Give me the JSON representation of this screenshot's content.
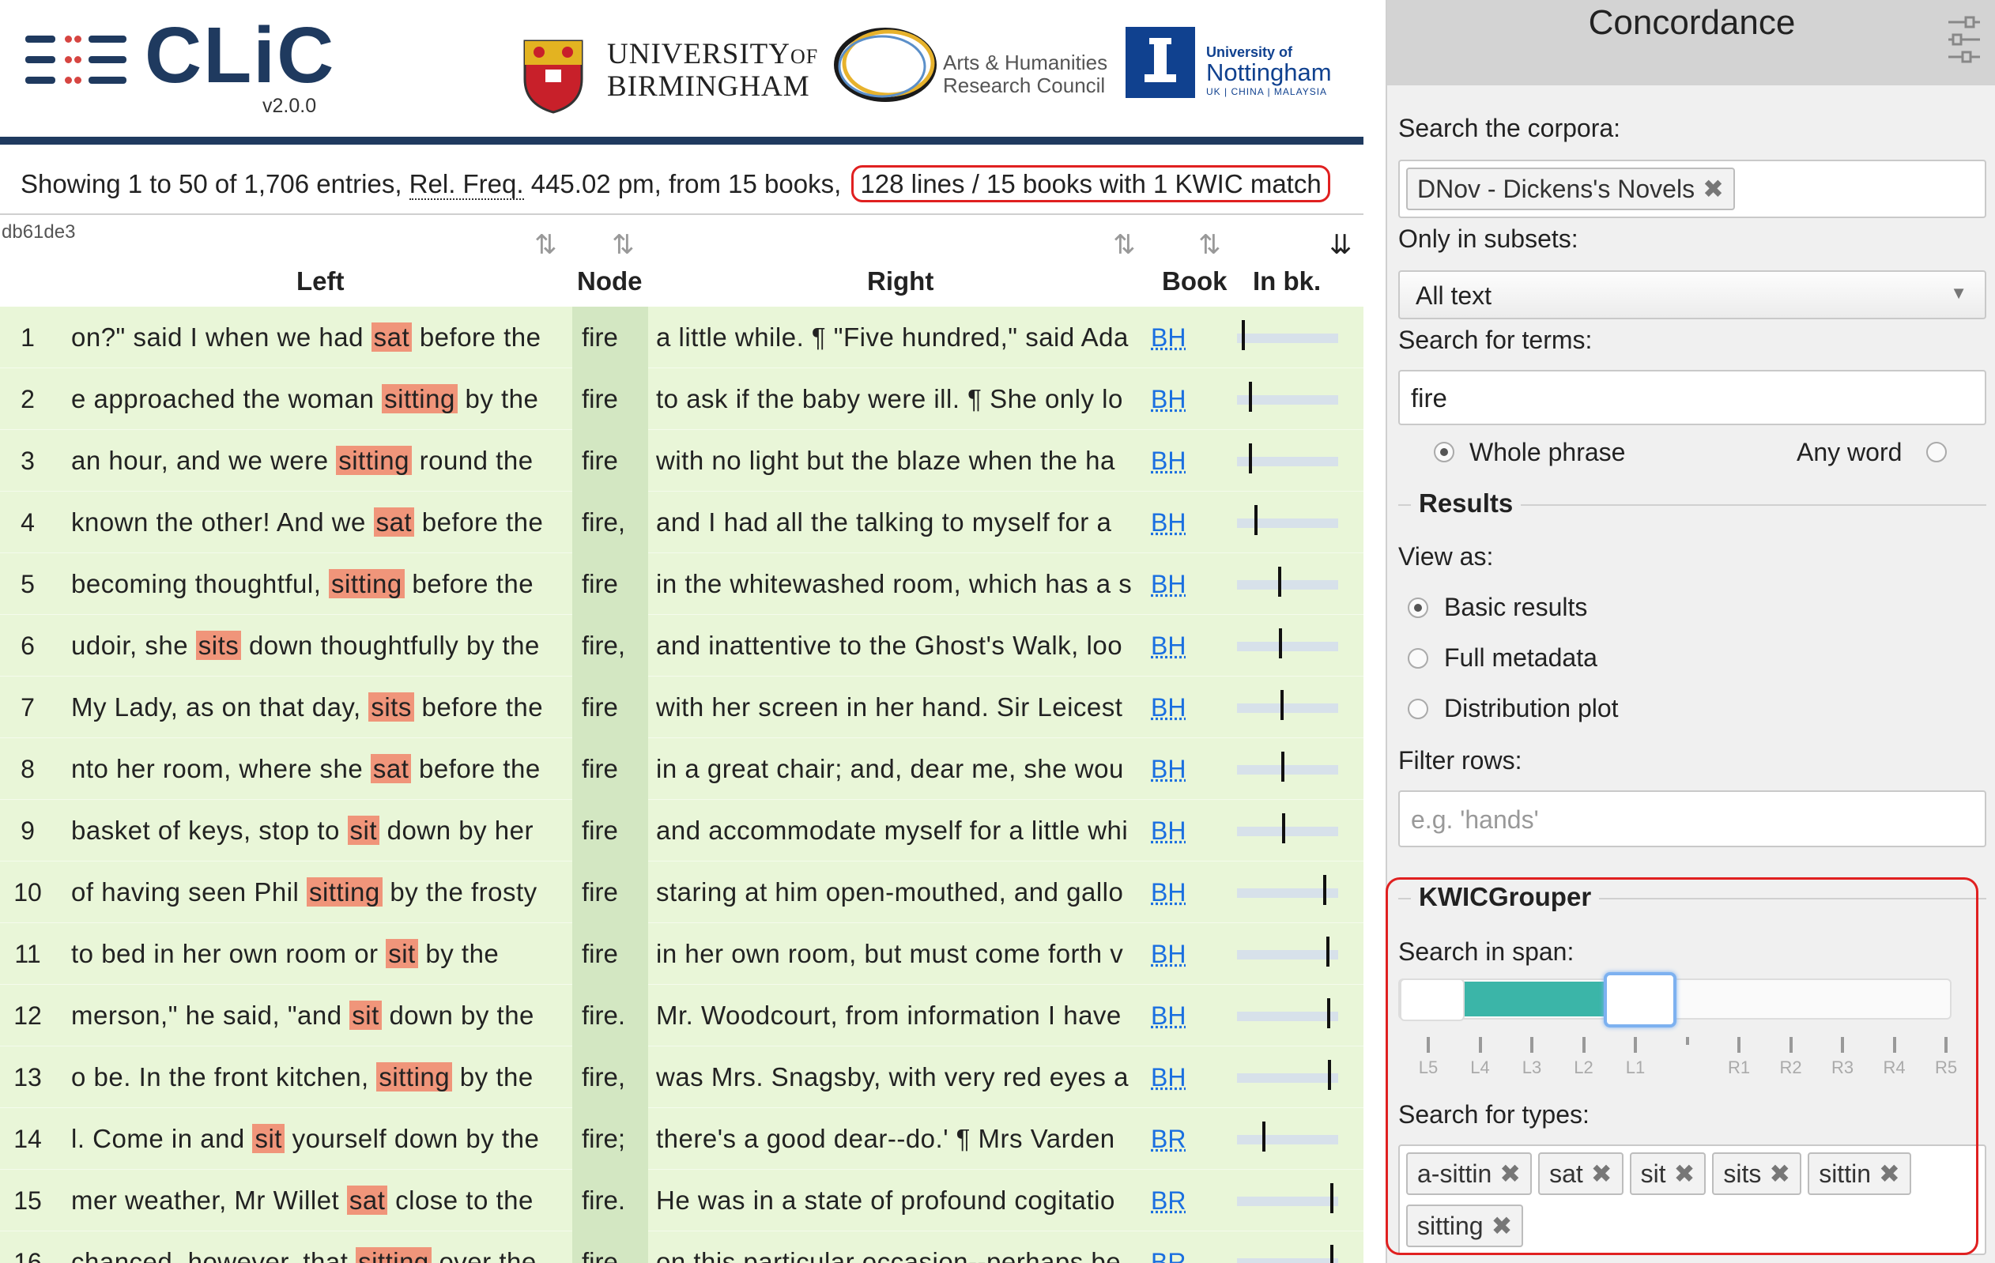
{
  "app": {
    "name": "CLiC",
    "version": "v2.0.0"
  },
  "logos": {
    "birmingham": "UNIVERSITY OF BIRMINGHAM",
    "birmingham_line1": "UNIVERSITY",
    "birmingham_of": "OF",
    "birmingham_line2": "BIRMINGHAM",
    "ahrc_line1": "Arts & Humanities",
    "ahrc_line2": "Research Council",
    "nottingham_line1": "University of",
    "nottingham_line2": "Nottingham",
    "nottingham_line3": "UK | CHINA | MALAYSIA"
  },
  "summary": {
    "prefix": "Showing 1 to 50 of 1,706 entries, ",
    "relfreq_abbr": "Rel. Freq.",
    "middle": " 445.02 pm, from 15 books, ",
    "kwic_match": "128 lines / 15 books with 1 KWIC match"
  },
  "table": {
    "id": "db61de3",
    "headers": {
      "left": "Left",
      "node": "Node",
      "right": "Right",
      "book": "Book",
      "inbk": "In bk."
    },
    "sort_icons": [
      "sort-icon",
      "sort-icon",
      "sort-icon",
      "sort-icon",
      "sort-desc-icon"
    ],
    "rows": [
      {
        "n": "1",
        "pre": "on?\" said I when we had ",
        "kw": "sat",
        "post": " before the",
        "node": "fire",
        "right": "a little while. ¶ \"Five hundred,\" said Ada",
        "book": "BH",
        "pos": 0.05
      },
      {
        "n": "2",
        "pre": "e approached the woman ",
        "kw": "sitting",
        "post": " by the",
        "node": "fire",
        "right": "to ask if the baby were ill. ¶ She only lo",
        "book": "BH",
        "pos": 0.12
      },
      {
        "n": "3",
        "pre": "an hour, and we were ",
        "kw": "sitting",
        "post": " round the",
        "node": "fire",
        "right": "with no light but the blaze when the ha",
        "book": "BH",
        "pos": 0.12
      },
      {
        "n": "4",
        "pre": "known the other! And we ",
        "kw": "sat",
        "post": " before the",
        "node": "fire,",
        "right": "and I had all the talking to myself for a",
        "book": "BH",
        "pos": 0.18
      },
      {
        "n": "5",
        "pre": "becoming thoughtful, ",
        "kw": "sitting",
        "post": " before the",
        "node": "fire",
        "right": "in the whitewashed room, which has a s",
        "book": "BH",
        "pos": 0.42
      },
      {
        "n": "6",
        "pre": "udoir, she ",
        "kw": "sits",
        "post": " down thoughtfully by the",
        "node": "fire,",
        "right": "and inattentive to the Ghost's Walk, loo",
        "book": "BH",
        "pos": 0.43
      },
      {
        "n": "7",
        "pre": "My Lady, as on that day, ",
        "kw": "sits",
        "post": " before the",
        "node": "fire",
        "right": "with her screen in her hand. Sir Leicest",
        "book": "BH",
        "pos": 0.44
      },
      {
        "n": "8",
        "pre": "nto her room, where she ",
        "kw": "sat",
        "post": " before the",
        "node": "fire",
        "right": "in a great chair; and, dear me, she wou",
        "book": "BH",
        "pos": 0.45
      },
      {
        "n": "9",
        "pre": "basket of keys, stop to ",
        "kw": "sit",
        "post": " down by her",
        "node": "fire",
        "right": "and accommodate myself for a little whi",
        "book": "BH",
        "pos": 0.46
      },
      {
        "n": "10",
        "pre": "of having seen Phil ",
        "kw": "sitting",
        "post": " by the frosty",
        "node": "fire",
        "right": "staring at him open-mouthed, and gallo",
        "book": "BH",
        "pos": 0.88
      },
      {
        "n": "11",
        "pre": " to bed in her own room or ",
        "kw": "sit",
        "post": " by the",
        "node": "fire",
        "right": "in her own room, but must come forth v",
        "book": "BH",
        "pos": 0.91
      },
      {
        "n": "12",
        "pre": "merson,\" he said, \"and ",
        "kw": "sit",
        "post": " down by the",
        "node": "fire.",
        "right": "Mr. Woodcourt, from information I have",
        "book": "BH",
        "pos": 0.92
      },
      {
        "n": "13",
        "pre": "o be. In the front kitchen, ",
        "kw": "sitting",
        "post": " by the",
        "node": "fire,",
        "right": "was Mrs. Snagsby, with very red eyes a",
        "book": "BH",
        "pos": 0.93
      },
      {
        "n": "14",
        "pre": "l. Come in and ",
        "kw": "sit",
        "post": " yourself down by the",
        "node": "fire;",
        "right": "there's a good dear--do.' ¶ Mrs Varden",
        "book": "BR",
        "pos": 0.26
      },
      {
        "n": "15",
        "pre": "mer weather, Mr Willet ",
        "kw": "sat",
        "post": " close to the",
        "node": "fire.",
        "right": "He was in a state of profound cogitatio",
        "book": "BR",
        "pos": 0.95
      },
      {
        "n": "16",
        "pre": "chanced, however, that ",
        "kw": "sitting",
        "post": " over the",
        "node": "fire",
        "right": "on this particular occasion--perhaps be",
        "book": "BR",
        "pos": 0.95
      }
    ]
  },
  "panel": {
    "title": "Concordance",
    "corpora_label": "Search the corpora:",
    "corpora_tags": [
      "DNov - Dickens's Novels"
    ],
    "subsets_label": "Only in subsets:",
    "subsets_value": "All text",
    "terms_label": "Search for terms:",
    "terms_value": "fire",
    "whole_phrase": "Whole phrase",
    "any_word": "Any word",
    "results_heading": "Results",
    "view_as_label": "View as:",
    "view_options": [
      "Basic results",
      "Full metadata",
      "Distribution plot"
    ],
    "filter_label": "Filter rows:",
    "filter_placeholder": "e.g. 'hands'",
    "kwic_heading": "KWICGrouper",
    "span_label": "Search in span:",
    "span_ticks": [
      "L5",
      "L4",
      "L3",
      "L2",
      "L1",
      "",
      "R1",
      "R2",
      "R3",
      "R4",
      "R5"
    ],
    "span_selected": [
      "L5",
      "L1"
    ],
    "types_label": "Search for types:",
    "types_tags": [
      "a-sittin",
      "sat",
      "sit",
      "sits",
      "sittin",
      "sitting"
    ]
  },
  "colors": {
    "brand": "#1f3a5f",
    "keyword_highlight": "#f0957a",
    "row_bg": "#e9f6d8",
    "node_bg": "#d3e7c2",
    "link": "#1a6fe0",
    "slider_fill": "#3bb5a8",
    "callout": "#e02020"
  }
}
